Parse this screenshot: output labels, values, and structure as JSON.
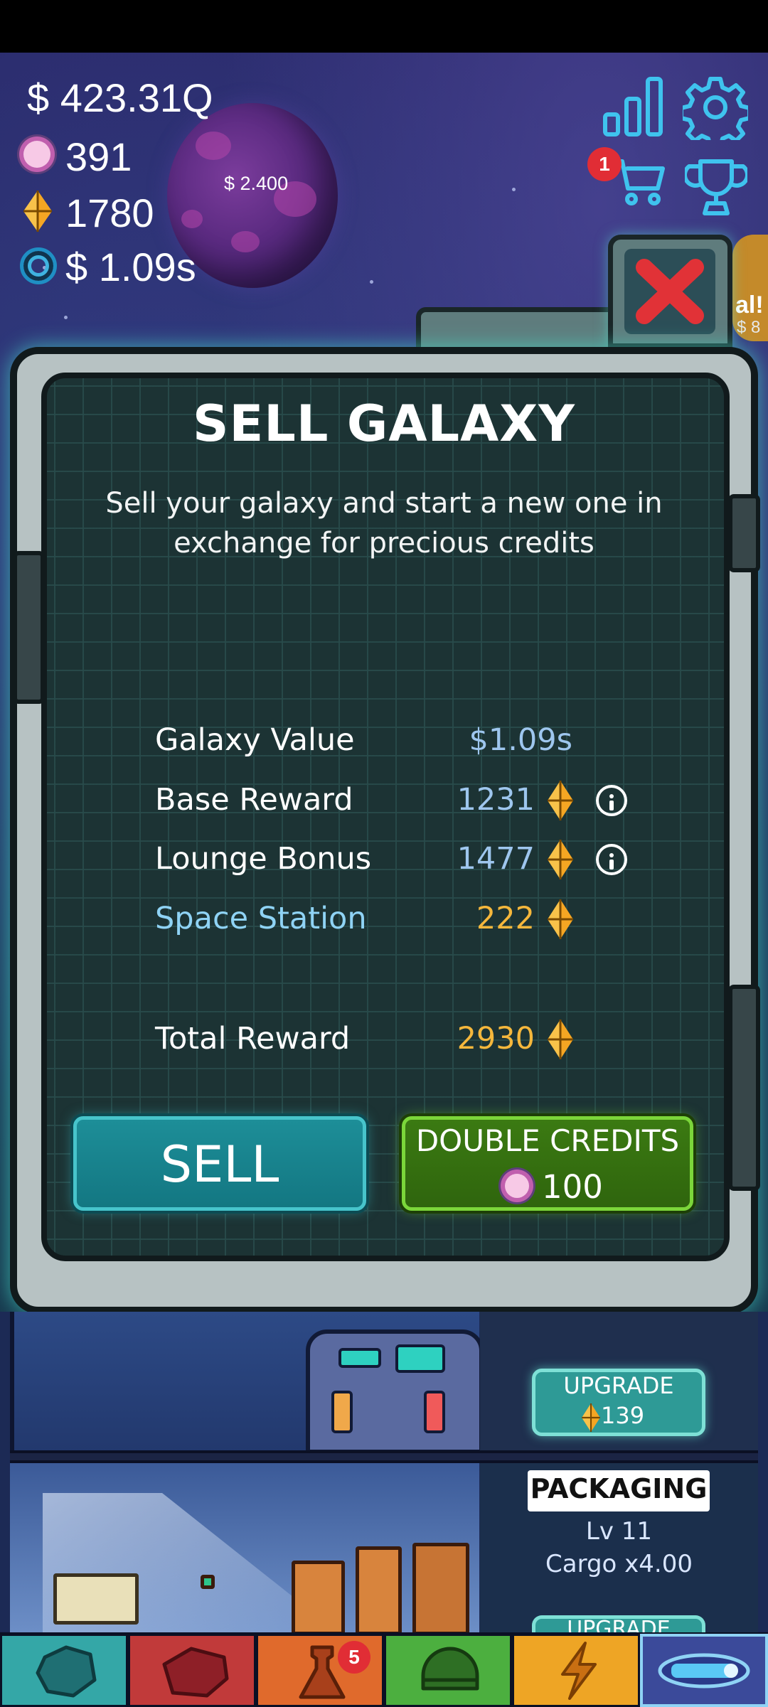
{
  "resources": {
    "money": "$ 423.31Q",
    "dark_matter": "391",
    "credits": "1780",
    "galaxy_value": "$ 1.09s"
  },
  "planet": {
    "price": "$ 2.400"
  },
  "top_right": {
    "cart_badge": "1"
  },
  "side_peek": {
    "text1": "al!",
    "text2": "$ 8"
  },
  "dialog": {
    "title": "SELL GALAXY",
    "subtitle": "Sell your galaxy and start a new one in exchange for precious credits",
    "rows": [
      {
        "label": "Galaxy Value",
        "value": "$1.09s"
      },
      {
        "label": "Base Reward",
        "value": "1231"
      },
      {
        "label": "Lounge Bonus",
        "value": "1477"
      },
      {
        "label": "Space Station",
        "value": "222"
      }
    ],
    "total": {
      "label": "Total Reward",
      "value": "2930"
    },
    "sell_button": "SELL",
    "double_button": {
      "label": "DOUBLE CREDITS",
      "cost": "100"
    }
  },
  "station": {
    "upgrade_1": {
      "label": "UPGRADE",
      "cost": "139"
    },
    "packaging": {
      "title": "PACKAGING",
      "level": "Lv 11",
      "cargo": "Cargo x4.00",
      "upgrade_label": "UPGRADE"
    }
  },
  "bottom_nav": {
    "badge": "5"
  },
  "colors": {
    "label_blue": "#8fd3f5",
    "value_blue": "#9ec6ee",
    "gold": "#f5b73c",
    "sell_teal": "#137782",
    "double_green": "#2f650d"
  }
}
